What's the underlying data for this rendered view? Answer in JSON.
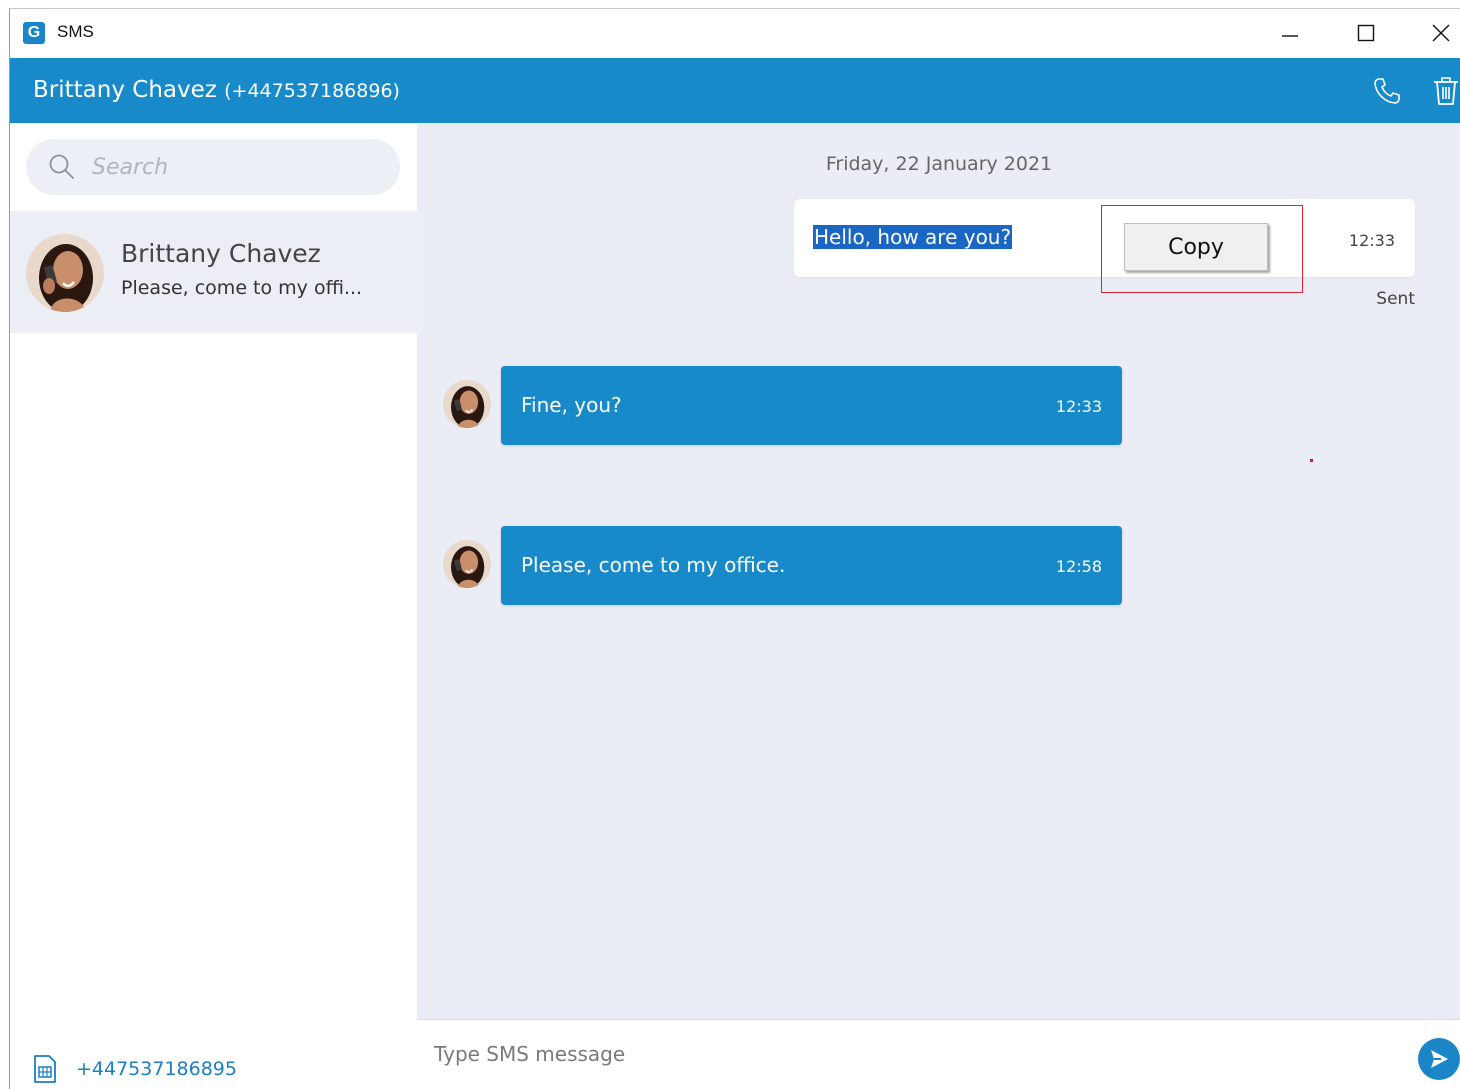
{
  "window": {
    "app_title": "SMS",
    "logo_letter": "G"
  },
  "header": {
    "contact_name": "Brittany Chavez",
    "contact_number": "(+447537186896)",
    "icons": [
      "phone-icon",
      "trash-icon"
    ]
  },
  "sidebar": {
    "search_placeholder": "Search",
    "conversations": [
      {
        "name": "Brittany Chavez",
        "preview": "Please, come to my offi..."
      }
    ],
    "sim_number": "+447537186895"
  },
  "chat": {
    "date": "Friday, 22 January 2021",
    "messages": [
      {
        "direction": "out",
        "text": "Hello, how are you?",
        "time": "12:33",
        "status": "Sent",
        "selected": true
      },
      {
        "direction": "in",
        "text": "Fine, you?",
        "time": "12:33"
      },
      {
        "direction": "in",
        "text": "Please, come to my office.",
        "time": "12:58"
      }
    ],
    "context_menu": {
      "copy_label": "Copy"
    }
  },
  "composer": {
    "placeholder": "Type SMS message"
  },
  "colors": {
    "accent": "#1889c9",
    "chat_background": "#eaedf5",
    "selection": "#1a66c4",
    "highlight_border": "#e0202a"
  }
}
